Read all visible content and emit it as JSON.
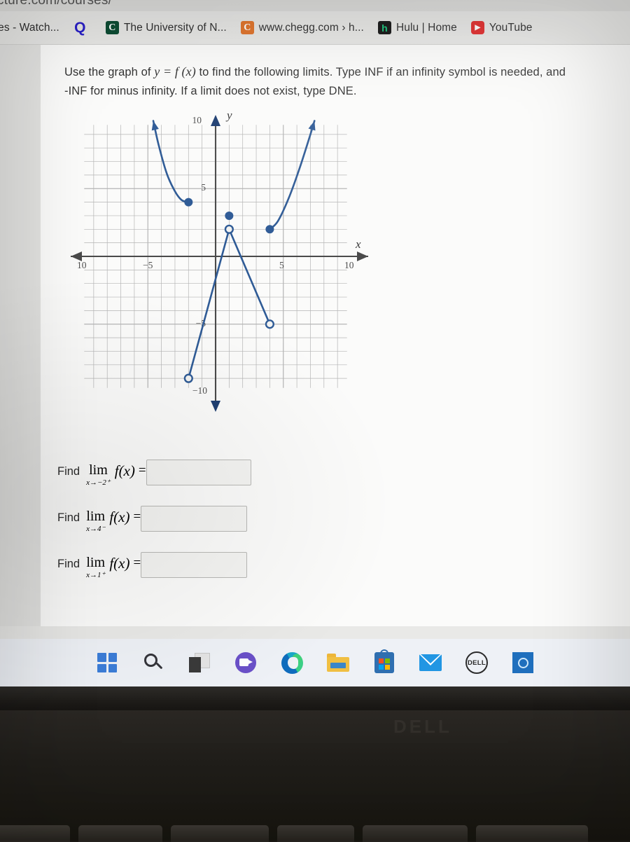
{
  "browser": {
    "url_fragment": "cture.com/courses/",
    "bookmarks": [
      {
        "label": "ovies - Watch...",
        "icon": "generic-favicon",
        "icon_glyph": ""
      },
      {
        "label": "",
        "icon": "qualtrics-icon",
        "icon_glyph": "Q"
      },
      {
        "label": "The University of N...",
        "icon": "unc-icon",
        "icon_glyph": "C"
      },
      {
        "label": "www.chegg.com › h...",
        "icon": "chegg-icon",
        "icon_glyph": "C"
      },
      {
        "label": "Hulu | Home",
        "icon": "hulu-icon",
        "icon_glyph": "h"
      },
      {
        "label": "YouTube",
        "icon": "youtube-icon",
        "icon_glyph": "▶"
      }
    ]
  },
  "question": {
    "line1_a": "Use the graph of ",
    "line1_math": "y = f (x)",
    "line1_b": " to find the following limits.  Type INF if an infinity symbol is needed, and",
    "line2": "-INF for minus infinity.  If a limit does not exist, type DNE."
  },
  "chart_data": {
    "type": "line",
    "title": "",
    "xlabel": "x",
    "ylabel": "y",
    "xlim": [
      -10,
      10
    ],
    "ylim": [
      -10,
      10
    ],
    "grid": true,
    "xticks": [
      -10,
      -5,
      5,
      10
    ],
    "yticks": [
      -10,
      -5,
      5,
      10
    ],
    "xtick_labels": [
      "10",
      "−5",
      "5",
      "10"
    ],
    "ytick_labels": [
      "−10",
      "−5",
      "5",
      "10"
    ],
    "axis_arrows": [
      "left",
      "right",
      "up",
      "down"
    ],
    "series": [
      {
        "name": "left-branch-curve",
        "style": "curve",
        "points": [
          [
            -4.6,
            10.0
          ],
          [
            -4.2,
            8.2
          ],
          [
            -3.6,
            6.1
          ],
          [
            -3.0,
            4.8
          ],
          [
            -2.5,
            4.15
          ],
          [
            -2.0,
            4.0
          ]
        ],
        "start_marker": "arrow",
        "end_marker": "closed-dot"
      },
      {
        "name": "rising-line-segment",
        "style": "line",
        "points": [
          [
            -2.0,
            -9.0
          ],
          [
            1.0,
            2.0
          ]
        ],
        "start_marker": "open-circle",
        "end_marker": "open-circle"
      },
      {
        "name": "falling-line-segment",
        "style": "line",
        "points": [
          [
            1.0,
            2.0
          ],
          [
            4.0,
            -5.0
          ]
        ],
        "start_marker": "open-circle",
        "end_marker": "open-circle"
      },
      {
        "name": "right-branch-curve",
        "style": "curve",
        "points": [
          [
            4.0,
            2.0
          ],
          [
            4.6,
            2.6
          ],
          [
            5.4,
            4.3
          ],
          [
            6.2,
            6.5
          ],
          [
            7.0,
            9.0
          ],
          [
            7.3,
            10.0
          ]
        ],
        "start_marker": "closed-dot",
        "end_marker": "arrow"
      }
    ],
    "closed_points": [
      [
        -2,
        4
      ],
      [
        1,
        3
      ],
      [
        4,
        2
      ]
    ],
    "open_points": [
      [
        -2,
        -9
      ],
      [
        1,
        2
      ],
      [
        4,
        -5
      ]
    ],
    "curve_color": "#2f5b96"
  },
  "limits": [
    {
      "find": "Find",
      "op": "lim",
      "sub": "x→−2⁺",
      "fn": "f(x)",
      "eq": "=",
      "value": "",
      "placeholder": ""
    },
    {
      "find": "Find",
      "op": "lim",
      "sub": "x→4⁻",
      "fn": "f(x)",
      "eq": "=",
      "value": "",
      "placeholder": ""
    },
    {
      "find": "Find",
      "op": "lim",
      "sub": "x→1⁺",
      "fn": "f(x)",
      "eq": "=",
      "value": "",
      "placeholder": ""
    }
  ],
  "taskbar": {
    "items": [
      {
        "name": "start-icon",
        "label": "Start"
      },
      {
        "name": "search-icon",
        "label": "Search"
      },
      {
        "name": "task-view-icon",
        "label": "Task View"
      },
      {
        "name": "teams-icon",
        "label": "Microsoft Teams"
      },
      {
        "name": "edge-icon",
        "label": "Microsoft Edge"
      },
      {
        "name": "file-explorer-icon",
        "label": "File Explorer"
      },
      {
        "name": "microsoft-store-icon",
        "label": "Microsoft Store"
      },
      {
        "name": "mail-icon",
        "label": "Mail"
      },
      {
        "name": "dell-icon",
        "label": "DELL"
      },
      {
        "name": "cortana-icon",
        "label": "Cortana"
      }
    ],
    "dell_text": "DELL"
  },
  "laptop": {
    "brand": "DELL"
  },
  "colors": {
    "curve": "#2f5b96",
    "axis": "#4a4a4a",
    "grid": "#9a9a9a",
    "page_bg": "#fbfbfa",
    "taskbar_bg": "#eef1f6"
  }
}
